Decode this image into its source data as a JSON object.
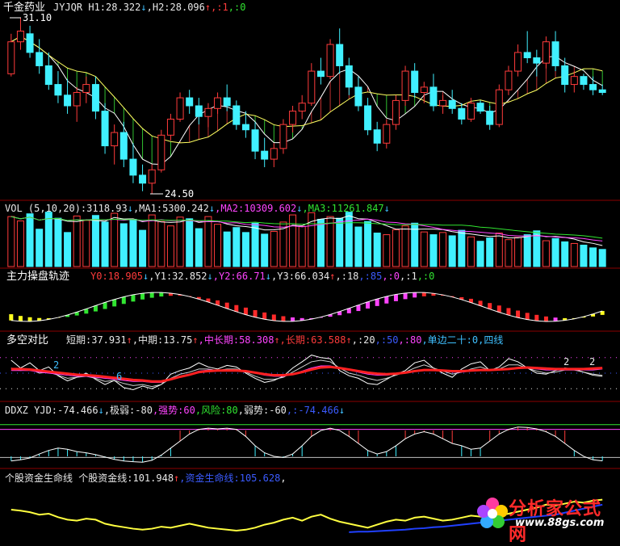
{
  "panels": {
    "main": {
      "name": "千金药业",
      "indicator": "JYJQR",
      "items": [
        {
          "text": "H1:28.322",
          "color": "#e8e8e8"
        },
        {
          "text": "↓",
          "color": "#3fc0ff"
        },
        {
          "text": ",H2:28.096",
          "color": "#e8e8e8"
        },
        {
          "text": "↑",
          "color": "#ff3b3b"
        },
        {
          "text": ",:1",
          "color": "#ff3b3b"
        },
        {
          "text": ",:0",
          "color": "#31e531"
        }
      ],
      "max_label": "31.10",
      "min_label": "24.50"
    },
    "vol": {
      "items": [
        {
          "text": "VOL (5,10,20):3118.93",
          "color": "#e8e8e8"
        },
        {
          "text": "↓",
          "color": "#3fc0ff"
        },
        {
          "text": ",MA1:5300.242",
          "color": "#e8e8e8"
        },
        {
          "text": "↓",
          "color": "#3fc0ff"
        },
        {
          "text": ",MA2:10309.602",
          "color": "#ff44ff"
        },
        {
          "text": "↓",
          "color": "#3fc0ff"
        },
        {
          "text": ",MA3:11261.847",
          "color": "#31e531"
        },
        {
          "text": "↓",
          "color": "#3fc0ff"
        }
      ]
    },
    "track": {
      "title": "主力操盘轨迹",
      "items": [
        {
          "text": "Y0:18.905",
          "color": "#ff3b3b"
        },
        {
          "text": "↓",
          "color": "#3fc0ff"
        },
        {
          "text": ",Y1:32.852",
          "color": "#e8e8e8"
        },
        {
          "text": "↓",
          "color": "#3fc0ff"
        },
        {
          "text": ",Y2:66.71",
          "color": "#ff44ff"
        },
        {
          "text": "↓",
          "color": "#3fc0ff"
        },
        {
          "text": ",Y3:66.034",
          "color": "#e8e8e8"
        },
        {
          "text": "↑",
          "color": "#ff3b3b"
        },
        {
          "text": ",:18",
          "color": "#e8e8e8"
        },
        {
          "text": ",:85",
          "color": "#3b5bff"
        },
        {
          "text": ",:0",
          "color": "#ff44ff"
        },
        {
          "text": ",:1",
          "color": "#e8e8e8"
        },
        {
          "text": ",:0",
          "color": "#31e531"
        }
      ]
    },
    "duokong": {
      "title": "多空对比",
      "items": [
        {
          "text": "短期:37.931",
          "color": "#e8e8e8"
        },
        {
          "text": "↑",
          "color": "#ff3b3b"
        },
        {
          "text": ",中期:13.75",
          "color": "#e8e8e8"
        },
        {
          "text": "↑",
          "color": "#ff3b3b"
        },
        {
          "text": ",中长期:58.308",
          "color": "#ff44ff"
        },
        {
          "text": "↑",
          "color": "#ff3b3b"
        },
        {
          "text": ",长期:63.588",
          "color": "#ff3b3b"
        },
        {
          "text": "↑",
          "color": "#ff3b3b"
        },
        {
          "text": ",:20",
          "color": "#e8e8e8"
        },
        {
          "text": ",:50",
          "color": "#3b5bff"
        },
        {
          "text": ",:80",
          "color": "#ff44ff"
        },
        {
          "text": ",单边二十:0",
          "color": "#3fc0ff"
        },
        {
          "text": ",四线",
          "color": "#3fc0ff"
        }
      ],
      "marks": [
        {
          "text": "2",
          "color": "#3fc0ff"
        },
        {
          "text": "6",
          "color": "#3fc0ff"
        },
        {
          "text": "2",
          "color": "#e8e8e8"
        },
        {
          "text": "2",
          "color": "#e8e8e8"
        }
      ]
    },
    "ddxz": {
      "items": [
        {
          "text": "DDXZ YJD:-74.466",
          "color": "#e8e8e8"
        },
        {
          "text": "↓",
          "color": "#3fc0ff"
        },
        {
          "text": ",极弱:-80",
          "color": "#e8e8e8"
        },
        {
          "text": ",强势:60",
          "color": "#ff44ff"
        },
        {
          "text": ",风险:80",
          "color": "#31e531"
        },
        {
          "text": ",弱势:-60",
          "color": "#e8e8e8"
        },
        {
          "text": ",:-74.466",
          "color": "#3b5bff"
        },
        {
          "text": "↓",
          "color": "#3fc0ff"
        }
      ]
    },
    "fund": {
      "items": [
        {
          "text": "个股资金生命线",
          "color": "#e8e8e8"
        },
        {
          "text": " 个股资金线:101.948",
          "color": "#e8e8e8"
        },
        {
          "text": "↑",
          "color": "#ff3b3b"
        },
        {
          "text": ",资金生命线:105.628",
          "color": "#3b5bff"
        },
        {
          "text": ",",
          "color": "#e8e8e8"
        }
      ]
    }
  },
  "watermark": {
    "title": "分析家公式网",
    "url": "www.88gs.com"
  },
  "chart_data": [
    {
      "type": "candlestick",
      "panel": "main",
      "max": 31.1,
      "min": 24.5,
      "ohlc": [
        [
          29.0,
          30.5,
          28.9,
          30.2
        ],
        [
          30.2,
          31.1,
          29.9,
          30.6
        ],
        [
          30.5,
          30.8,
          29.6,
          29.8
        ],
        [
          29.8,
          30.3,
          29.0,
          29.3
        ],
        [
          29.3,
          29.8,
          28.4,
          28.6
        ],
        [
          28.6,
          29.1,
          27.9,
          28.2
        ],
        [
          28.2,
          28.8,
          27.5,
          27.8
        ],
        [
          27.8,
          28.5,
          27.2,
          28.3
        ],
        [
          28.3,
          28.9,
          27.9,
          28.6
        ],
        [
          28.6,
          28.9,
          27.3,
          27.6
        ],
        [
          27.6,
          27.9,
          26.0,
          26.3
        ],
        [
          26.3,
          27.1,
          25.6,
          26.8
        ],
        [
          26.8,
          27.2,
          25.5,
          25.8
        ],
        [
          25.8,
          26.4,
          24.9,
          25.2
        ],
        [
          25.2,
          25.6,
          24.6,
          24.9
        ],
        [
          24.9,
          25.6,
          24.5,
          25.4
        ],
        [
          25.4,
          26.9,
          25.3,
          26.7
        ],
        [
          26.7,
          27.5,
          26.5,
          27.3
        ],
        [
          27.3,
          28.3,
          27.2,
          28.1
        ],
        [
          28.1,
          28.4,
          27.5,
          27.8
        ],
        [
          27.8,
          28.1,
          27.1,
          27.4
        ],
        [
          27.4,
          27.9,
          27.0,
          27.7
        ],
        [
          27.7,
          28.3,
          27.5,
          28.1
        ],
        [
          28.1,
          28.6,
          27.6,
          27.8
        ],
        [
          27.8,
          28.0,
          26.9,
          27.1
        ],
        [
          27.1,
          27.6,
          26.6,
          26.9
        ],
        [
          26.9,
          27.2,
          25.8,
          26.1
        ],
        [
          26.1,
          26.6,
          25.5,
          25.8
        ],
        [
          25.8,
          26.4,
          25.5,
          26.2
        ],
        [
          26.2,
          27.3,
          26.0,
          27.1
        ],
        [
          27.1,
          27.8,
          26.8,
          27.6
        ],
        [
          27.6,
          28.2,
          27.3,
          27.9
        ],
        [
          27.9,
          29.4,
          27.8,
          29.1
        ],
        [
          29.1,
          29.6,
          28.6,
          28.9
        ],
        [
          28.9,
          30.3,
          28.8,
          30.1
        ],
        [
          30.1,
          30.7,
          29.0,
          29.3
        ],
        [
          29.3,
          29.6,
          28.2,
          28.5
        ],
        [
          28.5,
          28.9,
          27.6,
          27.8
        ],
        [
          27.8,
          28.1,
          26.7,
          26.9
        ],
        [
          26.9,
          27.2,
          26.1,
          26.4
        ],
        [
          26.4,
          27.3,
          26.2,
          27.1
        ],
        [
          27.1,
          28.2,
          26.9,
          28.0
        ],
        [
          28.0,
          29.3,
          27.8,
          29.1
        ],
        [
          29.1,
          29.4,
          28.1,
          28.3
        ],
        [
          28.3,
          28.7,
          27.9,
          28.5
        ],
        [
          28.5,
          29.0,
          27.6,
          27.8
        ],
        [
          27.8,
          28.2,
          27.5,
          28.0
        ],
        [
          28.0,
          28.4,
          27.5,
          27.7
        ],
        [
          27.7,
          27.9,
          27.1,
          27.3
        ],
        [
          27.3,
          28.1,
          27.2,
          27.9
        ],
        [
          27.9,
          28.0,
          27.5,
          27.6
        ],
        [
          27.6,
          27.8,
          26.9,
          27.1
        ],
        [
          27.1,
          28.6,
          27.0,
          28.4
        ],
        [
          28.4,
          29.3,
          28.2,
          29.1
        ],
        [
          29.1,
          30.1,
          28.9,
          29.8
        ],
        [
          29.8,
          30.6,
          29.4,
          29.6
        ],
        [
          29.6,
          29.9,
          28.9,
          29.4
        ],
        [
          29.4,
          30.4,
          29.2,
          30.2
        ],
        [
          30.2,
          30.6,
          29.1,
          29.3
        ],
        [
          29.3,
          29.6,
          28.3,
          28.6
        ],
        [
          28.6,
          29.1,
          28.3,
          28.9
        ],
        [
          28.9,
          29.0,
          28.4,
          28.6
        ],
        [
          28.6,
          28.9,
          28.2,
          28.4
        ],
        [
          28.4,
          28.6,
          28.2,
          28.3
        ]
      ]
    },
    {
      "type": "bar",
      "panel": "vol",
      "values": [
        9100,
        8300,
        9600,
        6800,
        9900,
        8800,
        6200,
        9200,
        8400,
        9300,
        8100,
        9700,
        7800,
        8600,
        6600,
        9400,
        8200,
        7400,
        9000,
        8700,
        6900,
        9100,
        7700,
        6300,
        7100,
        6200,
        7900,
        5900,
        6400,
        8100,
        9400,
        7300,
        9800,
        8600,
        9100,
        8800,
        9900,
        7200,
        8200,
        6100,
        5800,
        6700,
        7400,
        7900,
        6300,
        5800,
        6200,
        5600,
        6600,
        5400,
        4600,
        5200,
        6100,
        4900,
        5300,
        5800,
        6500,
        4700,
        5100,
        4500,
        4200,
        3900,
        3400,
        3118.93
      ]
    },
    {
      "type": "line",
      "panel": "duokong",
      "series": [
        {
          "name": "短期",
          "color": "#ffffff",
          "values": [
            75,
            60,
            70,
            55,
            62,
            45,
            35,
            42,
            50,
            38,
            28,
            36,
            22,
            18,
            25,
            20,
            28,
            48,
            55,
            60,
            70,
            62,
            58,
            65,
            62,
            50,
            40,
            32,
            36,
            44,
            60,
            72,
            85,
            80,
            78,
            55,
            45,
            40,
            30,
            28,
            38,
            48,
            55,
            70,
            75,
            60,
            50,
            42,
            58,
            68,
            72,
            55,
            62,
            78,
            72,
            60,
            50,
            48,
            55,
            60,
            58,
            52,
            46,
            44
          ]
        },
        {
          "name": "中期",
          "color": "#d0d0d0",
          "values": [
            60,
            55,
            58,
            50,
            52,
            46,
            40,
            42,
            44,
            40,
            34,
            36,
            30,
            26,
            28,
            24,
            28,
            40,
            48,
            52,
            58,
            58,
            55,
            58,
            58,
            52,
            44,
            38,
            38,
            42,
            52,
            62,
            72,
            75,
            72,
            60,
            50,
            46,
            40,
            36,
            40,
            46,
            52,
            60,
            66,
            60,
            54,
            48,
            52,
            58,
            62,
            56,
            58,
            66,
            66,
            60,
            54,
            50,
            52,
            56,
            56,
            52,
            48,
            46
          ]
        },
        {
          "name": "中长期",
          "color": "#ff44ff",
          "values": [
            55,
            55,
            55,
            52,
            50,
            48,
            46,
            44,
            44,
            42,
            40,
            38,
            36,
            34,
            34,
            32,
            32,
            38,
            44,
            48,
            54,
            56,
            56,
            56,
            56,
            54,
            50,
            46,
            44,
            44,
            48,
            54,
            60,
            64,
            64,
            60,
            56,
            52,
            48,
            46,
            46,
            48,
            50,
            54,
            56,
            56,
            54,
            52,
            52,
            54,
            56,
            56,
            56,
            58,
            60,
            60,
            58,
            56,
            56,
            56,
            56,
            56,
            56,
            58
          ]
        },
        {
          "name": "长期",
          "color": "#ff2020",
          "values": [
            58,
            58,
            57,
            55,
            53,
            51,
            49,
            47,
            46,
            45,
            43,
            41,
            39,
            37,
            36,
            34,
            34,
            38,
            43,
            47,
            52,
            54,
            55,
            55,
            55,
            54,
            51,
            48,
            46,
            46,
            48,
            52,
            57,
            61,
            62,
            60,
            57,
            54,
            51,
            49,
            48,
            49,
            51,
            54,
            56,
            56,
            55,
            54,
            54,
            55,
            56,
            56,
            57,
            58,
            60,
            61,
            60,
            59,
            58,
            58,
            58,
            58,
            59,
            60
          ]
        }
      ],
      "ylim": [
        0,
        100
      ]
    },
    {
      "type": "line",
      "panel": "ddxz",
      "values": [
        -75,
        -70,
        -62,
        -45,
        -30,
        -20,
        -25,
        -35,
        -40,
        -48,
        -58,
        -68,
        -75,
        -78,
        -80,
        -72,
        -50,
        -20,
        10,
        40,
        60,
        65,
        62,
        65,
        60,
        30,
        -10,
        -40,
        -55,
        -60,
        -45,
        -10,
        30,
        55,
        65,
        55,
        30,
        0,
        -30,
        -45,
        -35,
        -10,
        20,
        40,
        50,
        40,
        20,
        0,
        -10,
        -25,
        -20,
        10,
        40,
        60,
        70,
        68,
        62,
        50,
        30,
        0,
        -30,
        -55,
        -70,
        -74.466
      ],
      "levels": [
        80,
        60,
        -60,
        -80
      ],
      "ylim": [
        -100,
        100
      ]
    },
    {
      "type": "line",
      "panel": "fund",
      "series": [
        {
          "name": "个股资金线",
          "color": "#ffff40",
          "values": [
            50,
            48,
            45,
            40,
            42,
            35,
            30,
            28,
            32,
            30,
            22,
            18,
            15,
            12,
            10,
            12,
            16,
            14,
            18,
            22,
            18,
            14,
            12,
            10,
            8,
            10,
            14,
            20,
            24,
            30,
            34,
            28,
            36,
            40,
            32,
            26,
            22,
            18,
            14,
            20,
            26,
            30,
            28,
            34,
            36,
            32,
            28,
            30,
            34,
            38,
            36,
            34,
            38,
            42,
            46,
            50,
            54,
            60,
            58,
            62,
            66,
            64,
            68,
            70
          ]
        },
        {
          "name": "资金生命线",
          "color": "#2040ff",
          "values": [
            null,
            null,
            null,
            null,
            null,
            null,
            null,
            null,
            null,
            null,
            null,
            null,
            null,
            null,
            null,
            null,
            null,
            null,
            null,
            null,
            null,
            null,
            null,
            null,
            null,
            null,
            null,
            null,
            null,
            null,
            null,
            null,
            null,
            null,
            null,
            null,
            5,
            6,
            6,
            7,
            8,
            9,
            10,
            12,
            13,
            15,
            16,
            18,
            20,
            22,
            24,
            26,
            28,
            30,
            32,
            34,
            36,
            38,
            40,
            44,
            48,
            52,
            56,
            60
          ]
        }
      ],
      "ylim": [
        0,
        100
      ]
    }
  ]
}
